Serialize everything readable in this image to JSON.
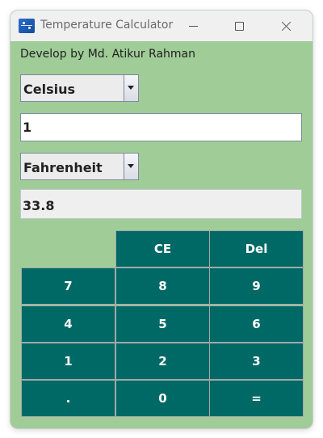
{
  "window": {
    "title": "Temperature Calculator"
  },
  "developer_label": "Develop by Md. Atikur Rahman",
  "from_unit": {
    "selected": "Celsius"
  },
  "input": {
    "value": "1"
  },
  "to_unit": {
    "selected": "Fahrenheit"
  },
  "result": {
    "value": "33.8"
  },
  "keypad": {
    "ce": "CE",
    "del": "Del",
    "k7": "7",
    "k8": "8",
    "k9": "9",
    "k4": "4",
    "k5": "5",
    "k6": "6",
    "k1": "1",
    "k2": "2",
    "k3": "3",
    "dot": ".",
    "k0": "0",
    "equals": "="
  },
  "colors": {
    "background": "#a0cc98",
    "button": "#006966"
  },
  "icons": {
    "app": "app-icon",
    "minimize": "minimize-icon",
    "maximize": "maximize-icon",
    "close": "close-icon"
  }
}
